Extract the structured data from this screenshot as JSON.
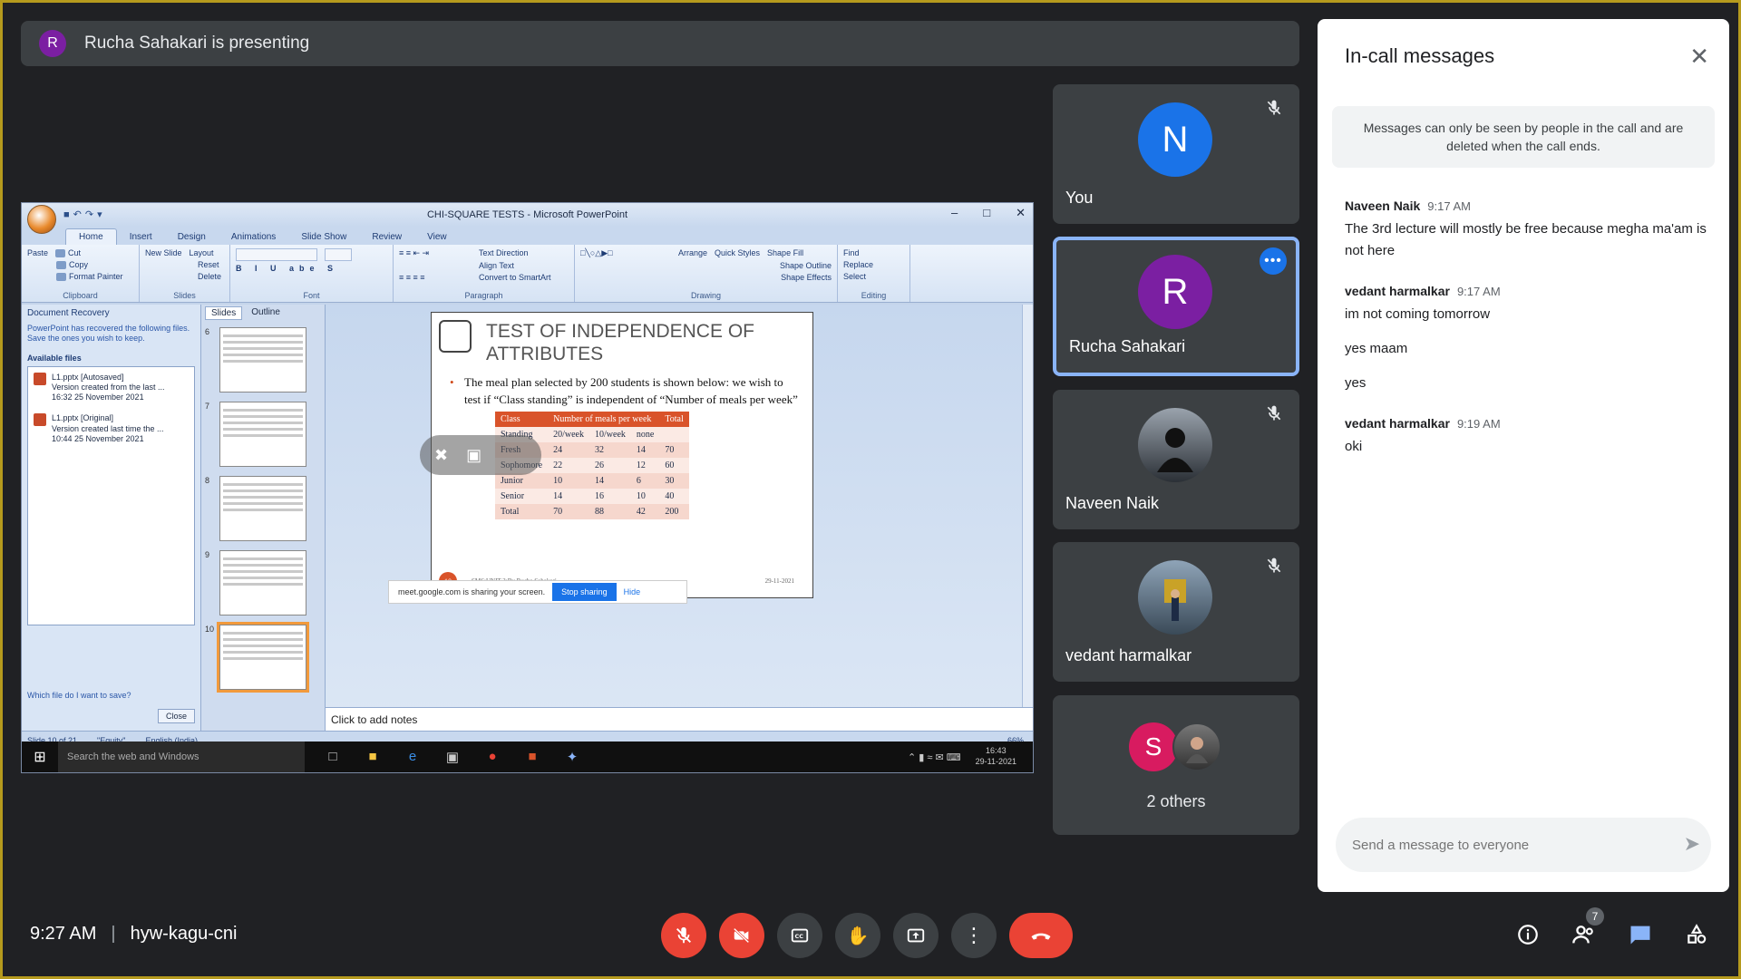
{
  "banner": {
    "avatar_letter": "R",
    "text": "Rucha Sahakari is presenting"
  },
  "screen": {
    "window_title": "CHI-SQUARE TESTS - Microsoft PowerPoint",
    "tabs": [
      "Home",
      "Insert",
      "Design",
      "Animations",
      "Slide Show",
      "Review",
      "View"
    ],
    "ribbon": {
      "clipboard": {
        "paste": "Paste",
        "cut": "Cut",
        "copy": "Copy",
        "format_painter": "Format Painter",
        "label": "Clipboard"
      },
      "slides": {
        "new_slide": "New Slide",
        "layout": "Layout",
        "reset": "Reset",
        "delete": "Delete",
        "label": "Slides"
      },
      "font": {
        "label": "Font"
      },
      "paragraph": {
        "text_direction": "Text Direction",
        "align_text": "Align Text",
        "convert": "Convert to SmartArt",
        "label": "Paragraph"
      },
      "drawing": {
        "arrange": "Arrange",
        "quick_styles": "Quick Styles",
        "shape_fill": "Shape Fill",
        "shape_outline": "Shape Outline",
        "shape_effects": "Shape Effects",
        "label": "Drawing"
      },
      "editing": {
        "find": "Find",
        "replace": "Replace",
        "select": "Select",
        "label": "Editing"
      }
    },
    "recovery": {
      "header": "Document Recovery",
      "message": "PowerPoint has recovered the following files. Save the ones you wish to keep.",
      "available": "Available files",
      "files": [
        {
          "name": "L1.pptx  [Autosaved]",
          "desc": "Version created from the last ...",
          "time": "16:32 25 November 2021"
        },
        {
          "name": "L1.pptx  [Original]",
          "desc": "Version created last time the ...",
          "time": "10:44 25 November 2021"
        }
      ],
      "which": "Which file do I want to save?",
      "close": "Close"
    },
    "slides_pane": {
      "tab_slides": "Slides",
      "tab_outline": "Outline",
      "numbers": [
        "6",
        "7",
        "8",
        "9",
        "10"
      ]
    },
    "slide": {
      "title": "TEST OF INDEPENDENCE OF ATTRIBUTES",
      "bullet": "The meal plan selected by 200 students is shown below: we wish to test if “Class standing” is independent of “Number of meals per week”",
      "table": {
        "headers": [
          "Class",
          "Number of meals per week",
          "",
          "",
          "Total"
        ],
        "rows": [
          [
            "Standing",
            "20/week",
            "10/week",
            "none",
            ""
          ],
          [
            "Fresh",
            "24",
            "32",
            "14",
            "70"
          ],
          [
            "Sophomore",
            "22",
            "26",
            "12",
            "60"
          ],
          [
            "Junior",
            "10",
            "14",
            "6",
            "30"
          ],
          [
            "Senior",
            "14",
            "16",
            "10",
            "40"
          ],
          [
            "Total",
            "70",
            "88",
            "42",
            "200"
          ]
        ]
      },
      "slide_number": "10",
      "footer": "SMS:UNIT 3:By Rucha Sahakari",
      "date": "29-11-2021"
    },
    "notes_placeholder": "Click to add notes",
    "share_bar": {
      "text": "meet.google.com is sharing your screen.",
      "stop": "Stop sharing",
      "hide": "Hide"
    },
    "status": {
      "slide": "Slide 10 of 21",
      "theme": "\"Equity\"",
      "language": "English (India)",
      "zoom": "66%"
    },
    "taskbar": {
      "search": "Search the web and Windows",
      "time": "16:43",
      "date": "29-11-2021"
    }
  },
  "participants": [
    {
      "name": "You",
      "letter": "N",
      "color": "#1a73e8",
      "muted": true
    },
    {
      "name": "Rucha Sahakari",
      "letter": "R",
      "color": "#7b1fa2",
      "muted": false,
      "active": true
    },
    {
      "name": "Naveen Naik",
      "letter": "",
      "muted": true
    },
    {
      "name": "vedant harmalkar",
      "letter": "",
      "muted": true
    }
  ],
  "others": {
    "letter": "S",
    "label": "2 others"
  },
  "chat": {
    "title": "In-call messages",
    "notice": "Messages can only be seen by people in the call and are deleted when the call ends.",
    "messages": [
      {
        "sender": "Naveen Naik",
        "time": "9:17 AM",
        "lines": [
          "The 3rd lecture will mostly be free because megha ma'am is not here"
        ]
      },
      {
        "sender": "vedant harmalkar",
        "time": "9:17 AM",
        "lines": [
          "im not coming tomorrow",
          "yes maam",
          "yes"
        ]
      },
      {
        "sender": "vedant harmalkar",
        "time": "9:19 AM",
        "lines": [
          "oki"
        ]
      }
    ],
    "input_placeholder": "Send a message to everyone"
  },
  "meeting": {
    "time": "9:27 AM",
    "code": "hyw-kagu-cni",
    "people_count": "7"
  }
}
